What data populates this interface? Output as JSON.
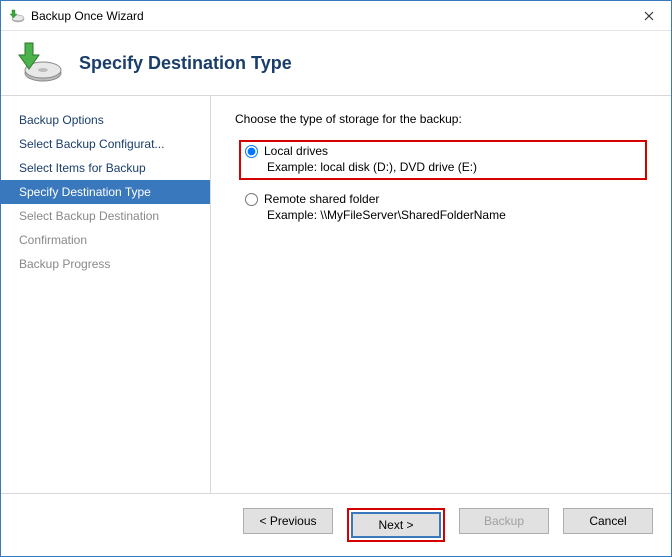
{
  "window": {
    "title": "Backup Once Wizard"
  },
  "header": {
    "title": "Specify Destination Type"
  },
  "sidebar": {
    "items": [
      {
        "label": "Backup Options"
      },
      {
        "label": "Select Backup Configurat..."
      },
      {
        "label": "Select Items for Backup"
      },
      {
        "label": "Specify Destination Type"
      },
      {
        "label": "Select Backup Destination"
      },
      {
        "label": "Confirmation"
      },
      {
        "label": "Backup Progress"
      }
    ]
  },
  "main": {
    "instruction": "Choose the type of storage for the backup:",
    "option_local": {
      "label": "Local drives",
      "example": "Example: local disk (D:), DVD drive (E:)"
    },
    "option_remote": {
      "label": "Remote shared folder",
      "example": "Example: \\\\MyFileServer\\SharedFolderName"
    }
  },
  "footer": {
    "previous": "< Previous",
    "next": "Next >",
    "backup": "Backup",
    "cancel": "Cancel"
  }
}
